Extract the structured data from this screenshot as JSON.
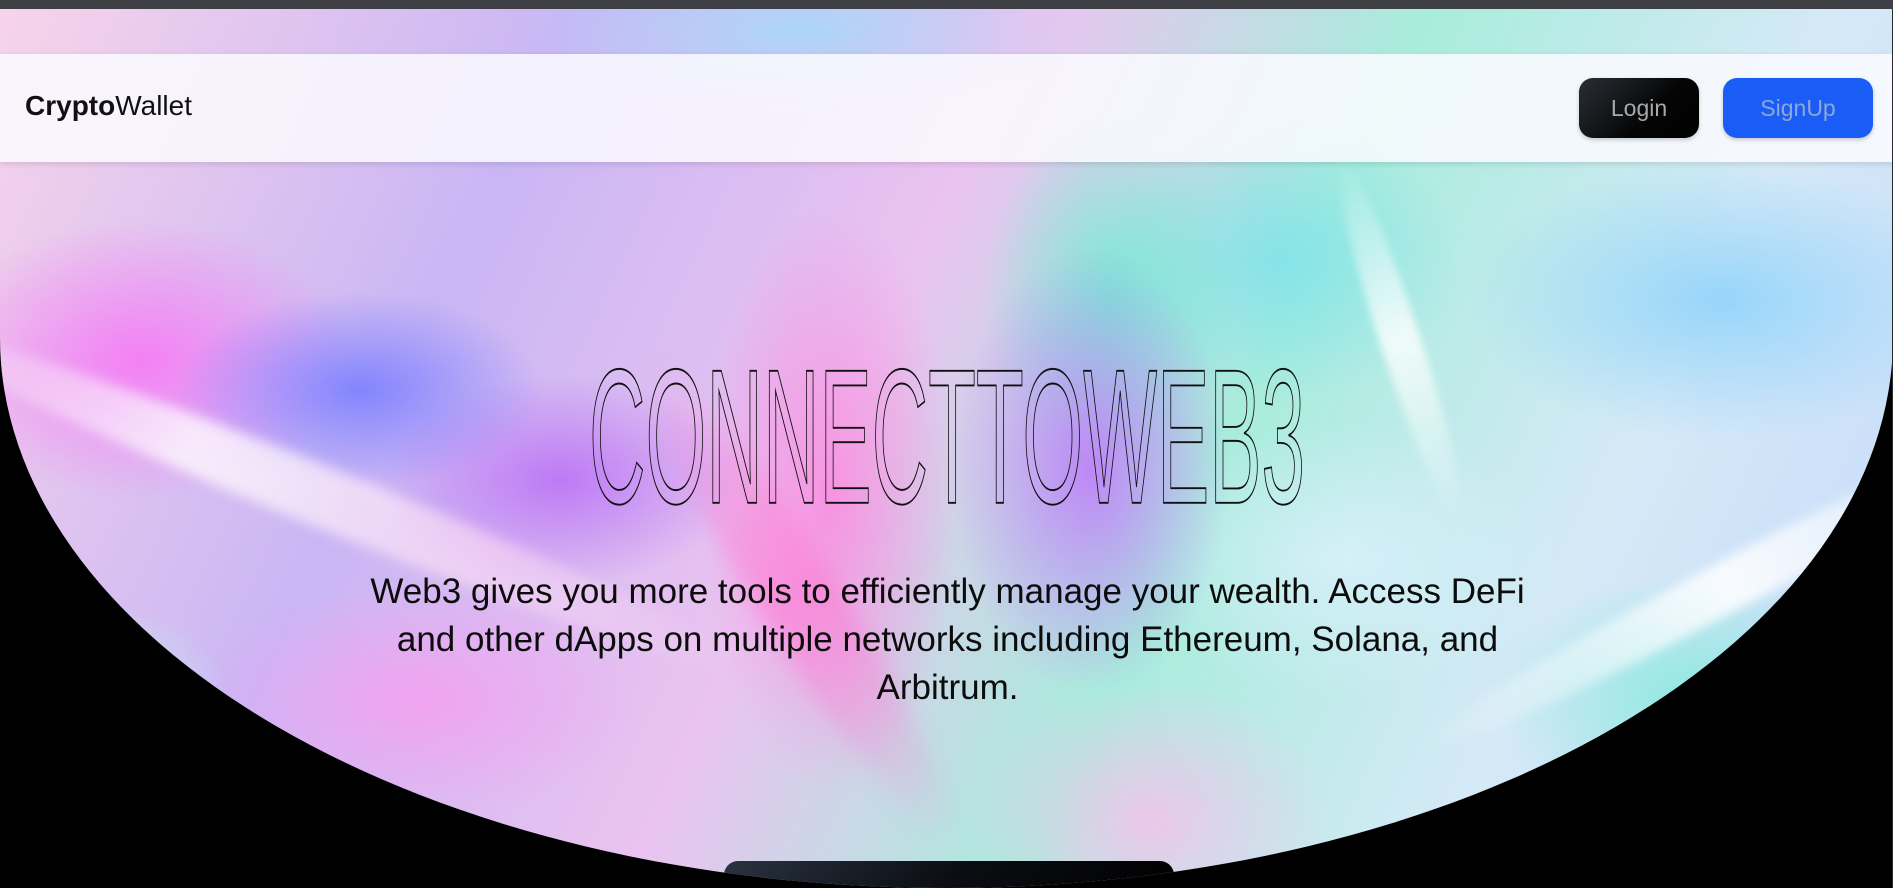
{
  "navbar": {
    "brand_bold": "Crypto",
    "brand_rest": "Wallet",
    "login_label": "Login",
    "signup_label": "SignUp"
  },
  "hero": {
    "headline": "CONNECTTOWEB3",
    "subtitle": "Web3 gives you more tools to efficiently manage your wealth. Access DeFi and other dApps on multiple networks including Ethereum, Solana, and Arbitrum."
  },
  "colors": {
    "login_button": "#000000",
    "signup_button": "#1a5cf6",
    "navbar_background": "#f8f8fd",
    "text": "#0c0c0c"
  }
}
